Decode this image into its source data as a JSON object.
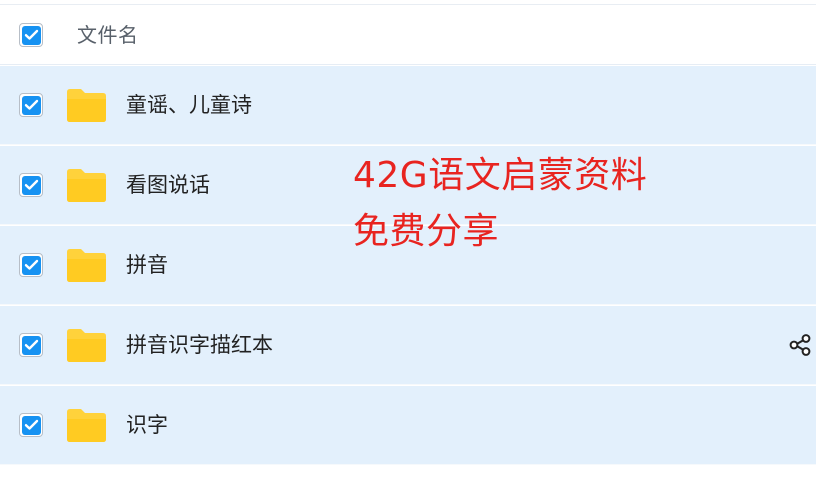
{
  "header": {
    "label": "文件名",
    "checked": true
  },
  "rows": [
    {
      "name": "童谣、儿童诗",
      "checked": true,
      "icon": "folder-icon",
      "share_visible": false
    },
    {
      "name": "看图说话",
      "checked": true,
      "icon": "folder-icon",
      "share_visible": false
    },
    {
      "name": "拼音",
      "checked": true,
      "icon": "folder-icon",
      "share_visible": false
    },
    {
      "name": "拼音识字描红本",
      "checked": true,
      "icon": "folder-icon",
      "share_visible": true
    },
    {
      "name": "识字",
      "checked": true,
      "icon": "folder-icon",
      "share_visible": false
    }
  ],
  "overlay": {
    "line1": "42G语文启蒙资料",
    "line2": "免费分享"
  },
  "colors": {
    "row_background": "#e3f0fc",
    "checkbox_blue": "#1692f2",
    "folder_yellow": "#ffd23b",
    "overlay_text": "#e82420"
  }
}
